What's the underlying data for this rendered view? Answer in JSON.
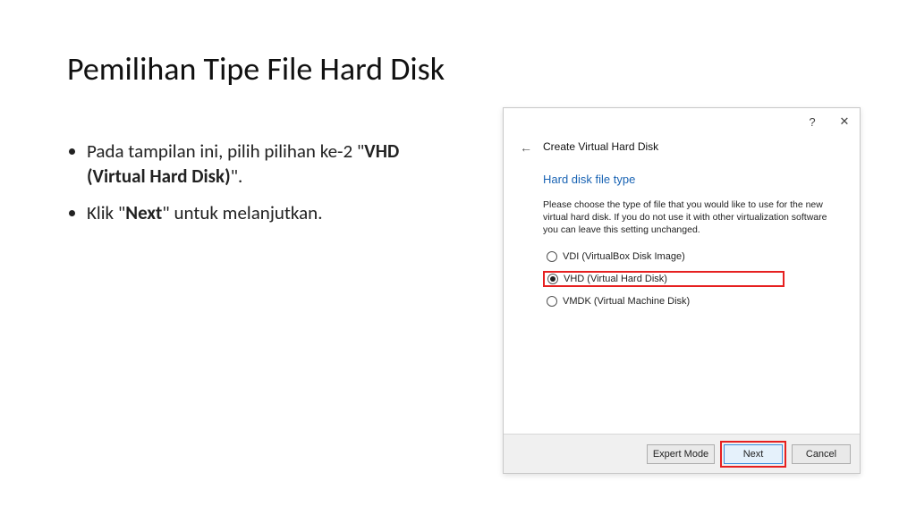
{
  "slide": {
    "title": "Pemilihan Tipe File Hard Disk",
    "bullet1_pre": "Pada tampilan ini, pilih pilihan ke-2 \"",
    "bullet1_bold": "VHD (Virtual Hard Disk)",
    "bullet1_post": "\".",
    "bullet2_pre": "Klik \"",
    "bullet2_bold": "Next",
    "bullet2_post": "\" untuk melanjutkan."
  },
  "dialog": {
    "heading": "Create Virtual Hard Disk",
    "section_title": "Hard disk file type",
    "description": "Please choose the type of file that you would like to use for the new virtual hard disk. If you do not use it with other virtualization software you can leave this setting unchanged.",
    "options": {
      "vdi": "VDI (VirtualBox Disk Image)",
      "vhd": "VHD (Virtual Hard Disk)",
      "vmdk": "VMDK (Virtual Machine Disk)"
    },
    "buttons": {
      "expert": "Expert Mode",
      "next": "Next",
      "cancel": "Cancel"
    },
    "titlebar": {
      "help": "?",
      "close": "✕"
    },
    "back_arrow": "←"
  }
}
